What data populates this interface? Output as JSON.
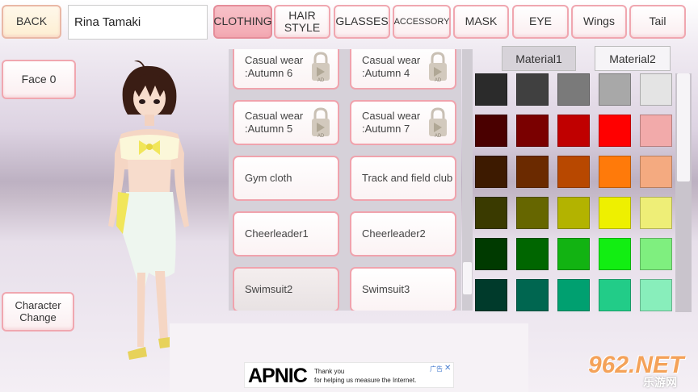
{
  "top_bar": {
    "back_label": "BACK",
    "character_name": "Rina Tamaki",
    "tabs": [
      {
        "label": "CLOTHING",
        "active": true
      },
      {
        "label": "HAIR\nSTYLE",
        "active": false
      },
      {
        "label": "GLASSES",
        "active": false
      },
      {
        "label": "ACCESSORY",
        "active": false
      },
      {
        "label": "MASK",
        "active": false
      },
      {
        "label": "EYE",
        "active": false
      },
      {
        "label": "Wings",
        "active": false
      },
      {
        "label": "Tail",
        "active": false
      }
    ]
  },
  "left_panel": {
    "face_label": "Face",
    "face_value": "0",
    "character_change_label": "Character\nChange"
  },
  "clothing_list": {
    "items": [
      {
        "label": "Casual wear\n:Autumn 6",
        "locked": true
      },
      {
        "label": "Casual wear\n:Autumn 4",
        "locked": true
      },
      {
        "label": "Casual wear\n:Autumn 5",
        "locked": true
      },
      {
        "label": "Casual wear\n:Autumn 7",
        "locked": true
      },
      {
        "label": "Gym cloth",
        "locked": false
      },
      {
        "label": "Track and field club",
        "locked": false
      },
      {
        "label": "Cheerleader1",
        "locked": false
      },
      {
        "label": "Cheerleader2",
        "locked": false
      },
      {
        "label": "Swimsuit2",
        "locked": false,
        "selected": true
      },
      {
        "label": "Swimsuit3",
        "locked": false
      }
    ],
    "scroll_position": 0.93,
    "lock_badge": "AD"
  },
  "materials": {
    "tabs": [
      {
        "label": "Material1",
        "active": true
      },
      {
        "label": "Material2",
        "active": false
      }
    ],
    "palette": [
      [
        "#2b2b2b",
        "#404040",
        "#7a7a7a",
        "#a8a8a8",
        "#e4e4e4"
      ],
      [
        "#4a0000",
        "#7a0000",
        "#c00000",
        "#ff0000",
        "#f2aaaa"
      ],
      [
        "#3d1a00",
        "#6b2a00",
        "#b84800",
        "#ff7a0a",
        "#f4aa80"
      ],
      [
        "#3a3a00",
        "#666600",
        "#b3b300",
        "#eef000",
        "#eeee77"
      ],
      [
        "#003a00",
        "#006600",
        "#12b312",
        "#12ee12",
        "#7fef7f"
      ],
      [
        "#003a2b",
        "#006650",
        "#00a070",
        "#22cc88",
        "#88eebb"
      ]
    ]
  },
  "ad": {
    "logo": "APNIC",
    "text_line1": "Thank you",
    "text_line2": "for helping us measure the Internet.",
    "tag": "广告",
    "close": "✕"
  },
  "watermark": {
    "main": "962.NET",
    "sub": "乐游网"
  }
}
